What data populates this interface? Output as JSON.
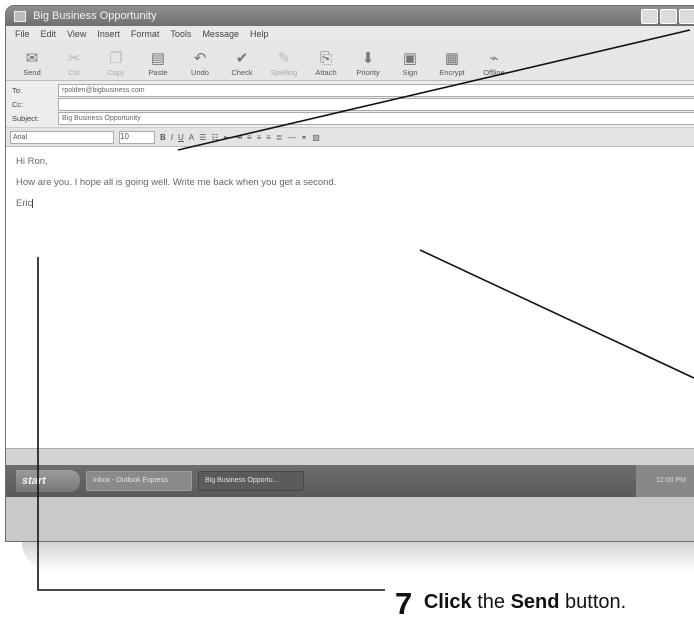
{
  "window": {
    "title": "Big Business Opportunity"
  },
  "menu": [
    "File",
    "Edit",
    "View",
    "Insert",
    "Format",
    "Tools",
    "Message",
    "Help"
  ],
  "toolbar": [
    {
      "label": "Send",
      "icon": "send-icon",
      "dim": false
    },
    {
      "label": "Cut",
      "icon": "scissors-icon",
      "dim": true
    },
    {
      "label": "Copy",
      "icon": "copy-icon",
      "dim": true
    },
    {
      "label": "Paste",
      "icon": "paste-icon",
      "dim": false
    },
    {
      "label": "Undo",
      "icon": "undo-icon",
      "dim": false
    },
    {
      "label": "Check",
      "icon": "check-icon",
      "dim": false
    },
    {
      "label": "Spelling",
      "icon": "spelling-icon",
      "dim": true
    },
    {
      "label": "Attach",
      "icon": "paperclip-icon",
      "dim": false
    },
    {
      "label": "Priority",
      "icon": "priority-icon",
      "dim": false
    },
    {
      "label": "Sign",
      "icon": "sign-icon",
      "dim": false
    },
    {
      "label": "Encrypt",
      "icon": "encrypt-icon",
      "dim": false
    },
    {
      "label": "Offline",
      "icon": "offline-icon",
      "dim": false
    }
  ],
  "header": {
    "to_label": "To:",
    "to_value": "rpolden@bigbusiness.com",
    "cc_label": "Cc:",
    "cc_value": "",
    "subject_label": "Subject:",
    "subject_value": "Big Business Opportunity"
  },
  "format": {
    "font": "Arial",
    "size": "10"
  },
  "message": {
    "greeting": "Hi Ron,",
    "line": "How are you. I hope all is going well. Write me back when you get a second.",
    "signoff": "Eric"
  },
  "taskbar": {
    "start": "start",
    "task1": "Inbox - Outlook Express",
    "task2": "Big Business Opportu...",
    "tray": "12:00 PM"
  },
  "caption": {
    "number": "7",
    "text1": "Click",
    "text2": "the",
    "text3": "Send",
    "text4": "button."
  }
}
